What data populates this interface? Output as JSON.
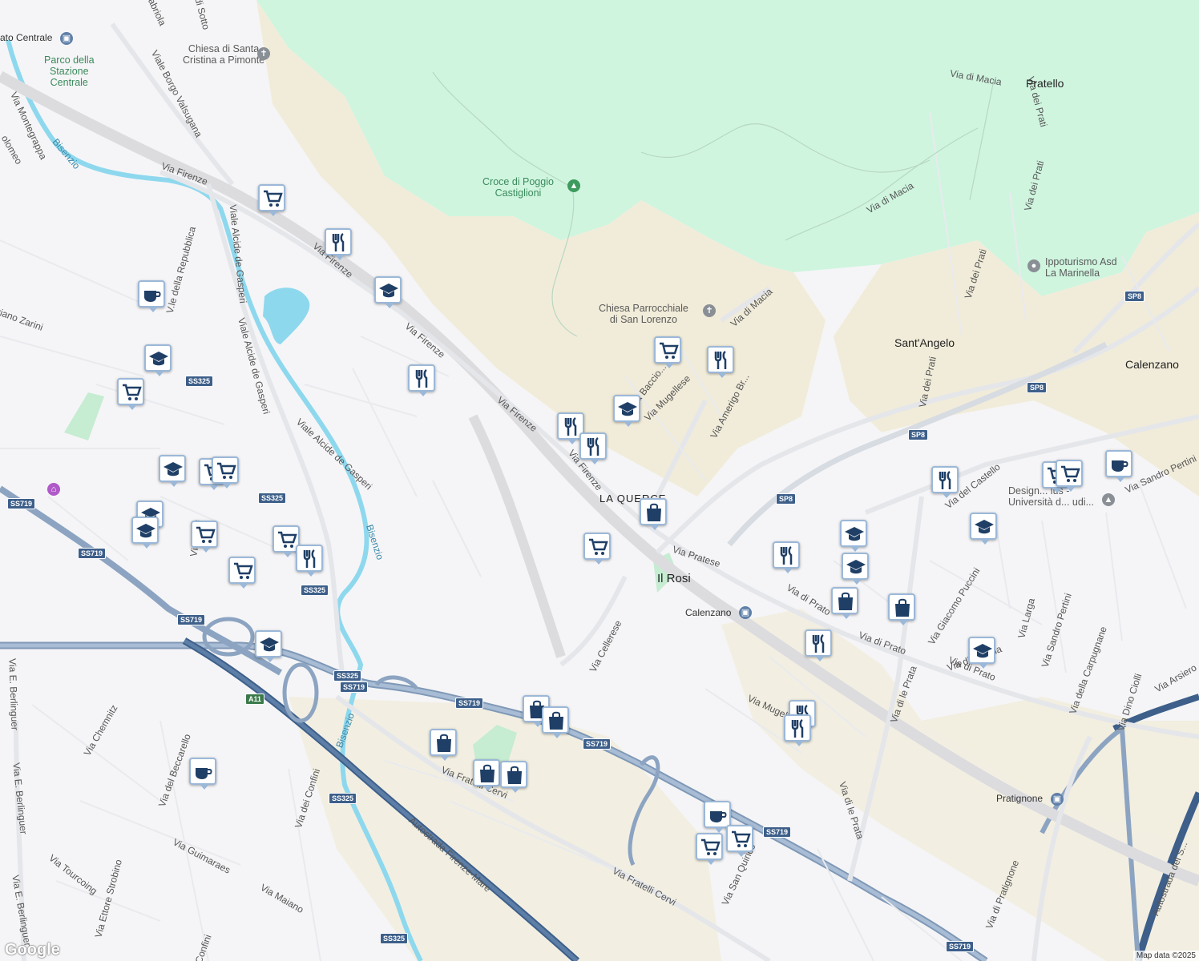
{
  "map": {
    "attribution": "Map data ©2025",
    "logo_text": "Google"
  },
  "places": [
    {
      "id": "la-querce",
      "text": "LA QUERCE"
    },
    {
      "id": "il-rosi",
      "text": "Il Rosi"
    },
    {
      "id": "santangelo",
      "text": "Sant'Angelo"
    },
    {
      "id": "calenzano",
      "text": "Calenzano"
    },
    {
      "id": "pratello",
      "text": "Pratello"
    },
    {
      "id": "calenzano-station",
      "text": "Calenzano"
    },
    {
      "id": "pratignone",
      "text": "Pratignone"
    },
    {
      "id": "prato-centrale",
      "text": "ato Centrale"
    }
  ],
  "pois": [
    {
      "id": "croce",
      "text": "Croce di Poggio\nCastiglioni"
    },
    {
      "id": "chiesa-santa-cristina",
      "text": "Chiesa di Santa\nCristina a Pimonte"
    },
    {
      "id": "chiesa-san-lorenzo",
      "text": "Chiesa Parrocchiale\ndi San Lorenzo"
    },
    {
      "id": "ippoturismo",
      "text": "Ippoturismo Asd\nLa Marinella"
    },
    {
      "id": "parco",
      "text": "Parco della\nStazione\nCentrale"
    },
    {
      "id": "design",
      "text": "Design... lus -\nUniversità d... udi..."
    }
  ],
  "roads": [
    {
      "text": "Via Firenze"
    },
    {
      "text": "Via Firenze"
    },
    {
      "text": "Via Firenze"
    },
    {
      "text": "Via Firenze"
    },
    {
      "text": "Via Firenze"
    },
    {
      "text": "Viale Borgo Valsugana"
    },
    {
      "text": "Viale Alcide de Gasperi"
    },
    {
      "text": "Viale Alcide de Gasperi"
    },
    {
      "text": "Viale Alcide de Gasperi"
    },
    {
      "text": "V.le della Repubblica"
    },
    {
      "text": "Via Pratese"
    },
    {
      "text": "Via di Prato"
    },
    {
      "text": "Via di Prato"
    },
    {
      "text": "Via di Prato"
    },
    {
      "text": "Via Cellerese"
    },
    {
      "text": "Via Fratelli Cervi"
    },
    {
      "text": "Via Fratelli Cervi"
    },
    {
      "text": "Autostrada Firenze-Mare"
    },
    {
      "text": "Via di Macia"
    },
    {
      "text": "Via di Macia"
    },
    {
      "text": "Via di Macia"
    },
    {
      "text": "Via dei Prati"
    },
    {
      "text": "Via dei Prati"
    },
    {
      "text": "Via dei Prati"
    },
    {
      "text": "Via dei Prati"
    },
    {
      "text": "Via Amerigo Br..."
    },
    {
      "text": "Via Mugellese"
    },
    {
      "text": "Via Baccio..."
    },
    {
      "text": "Via del Castello"
    },
    {
      "text": "Via Sandro Pertini"
    },
    {
      "text": "Via Sandro Pertini"
    },
    {
      "text": "Via Giacomo Puccini"
    },
    {
      "text": "Via Larga"
    },
    {
      "text": "Via della Carpugnane"
    },
    {
      "text": "Via Dino Ciolli"
    },
    {
      "text": "Via Arsiero"
    },
    {
      "text": "Via di le Prata"
    },
    {
      "text": "Via di le Prata"
    },
    {
      "text": "Via di Pratignone"
    },
    {
      "text": "Autostrada del S..."
    },
    {
      "text": "Via E. Berlinguer"
    },
    {
      "text": "Via E. Berlinguer"
    },
    {
      "text": "Via E. Berlinguer"
    },
    {
      "text": "Via Chemnitz"
    },
    {
      "text": "Via del Beccarello"
    },
    {
      "text": "Via dei Confini"
    },
    {
      "text": "Via Guimaraes"
    },
    {
      "text": "Via Tourcoing"
    },
    {
      "text": "Via Ettore Strobino"
    },
    {
      "text": "Via Maiano"
    },
    {
      "text": "Confini"
    },
    {
      "text": "Via San Quirico"
    },
    {
      "text": "Via Mugellese"
    },
    {
      "text": "Via Montegrappa"
    },
    {
      "text": "olomeo"
    },
    {
      "text": "riano Zarini"
    },
    {
      "text": "abriola"
    },
    {
      "text": "di Sotto"
    },
    {
      "text": "Bisenzio"
    },
    {
      "text": "Bisenzio"
    },
    {
      "text": "Bisenzio"
    },
    {
      "text": "Via Fauli"
    },
    {
      "text": "Via di Vigliaia"
    }
  ],
  "shields": [
    "SS325",
    "SS325",
    "SS325",
    "SS325",
    "SS325",
    "SS325",
    "SS719",
    "SS719",
    "SS719",
    "SS719",
    "SS719",
    "SS719",
    "SS719",
    "SS719",
    "A11",
    "SP8",
    "SP8",
    "SP8",
    "SP8"
  ],
  "markers": [
    {
      "type": "grocery-icon"
    },
    {
      "type": "restaurant-icon"
    },
    {
      "type": "school-icon"
    },
    {
      "type": "restaurant-icon"
    },
    {
      "type": "cafe-icon"
    },
    {
      "type": "school-icon"
    },
    {
      "type": "grocery-icon"
    },
    {
      "type": "grocery-icon"
    },
    {
      "type": "school-icon"
    },
    {
      "type": "grocery-icon"
    },
    {
      "type": "school-icon"
    },
    {
      "type": "school-icon"
    },
    {
      "type": "grocery-icon"
    },
    {
      "type": "grocery-icon"
    },
    {
      "type": "restaurant-icon"
    },
    {
      "type": "grocery-icon"
    },
    {
      "type": "school-icon"
    },
    {
      "type": "cafe-icon"
    },
    {
      "type": "restaurant-icon"
    },
    {
      "type": "restaurant-icon"
    },
    {
      "type": "school-icon"
    },
    {
      "type": "grocery-icon"
    },
    {
      "type": "restaurant-icon"
    },
    {
      "type": "shopping-bag-icon"
    },
    {
      "type": "grocery-icon"
    },
    {
      "type": "shopping-bag-icon"
    },
    {
      "type": "shopping-bag-icon"
    },
    {
      "type": "shopping-bag-icon"
    },
    {
      "type": "shopping-bag-icon"
    },
    {
      "type": "shopping-bag-icon"
    },
    {
      "type": "restaurant-icon"
    },
    {
      "type": "school-icon"
    },
    {
      "type": "school-icon"
    },
    {
      "type": "shopping-bag-icon"
    },
    {
      "type": "shopping-bag-icon"
    },
    {
      "type": "restaurant-icon"
    },
    {
      "type": "restaurant-icon"
    },
    {
      "type": "restaurant-icon"
    },
    {
      "type": "school-icon"
    },
    {
      "type": "school-icon"
    },
    {
      "type": "grocery-icon"
    },
    {
      "type": "grocery-icon"
    },
    {
      "type": "cafe-icon"
    },
    {
      "type": "restaurant-icon"
    },
    {
      "type": "cafe-icon"
    },
    {
      "type": "grocery-icon"
    },
    {
      "type": "grocery-icon"
    }
  ]
}
